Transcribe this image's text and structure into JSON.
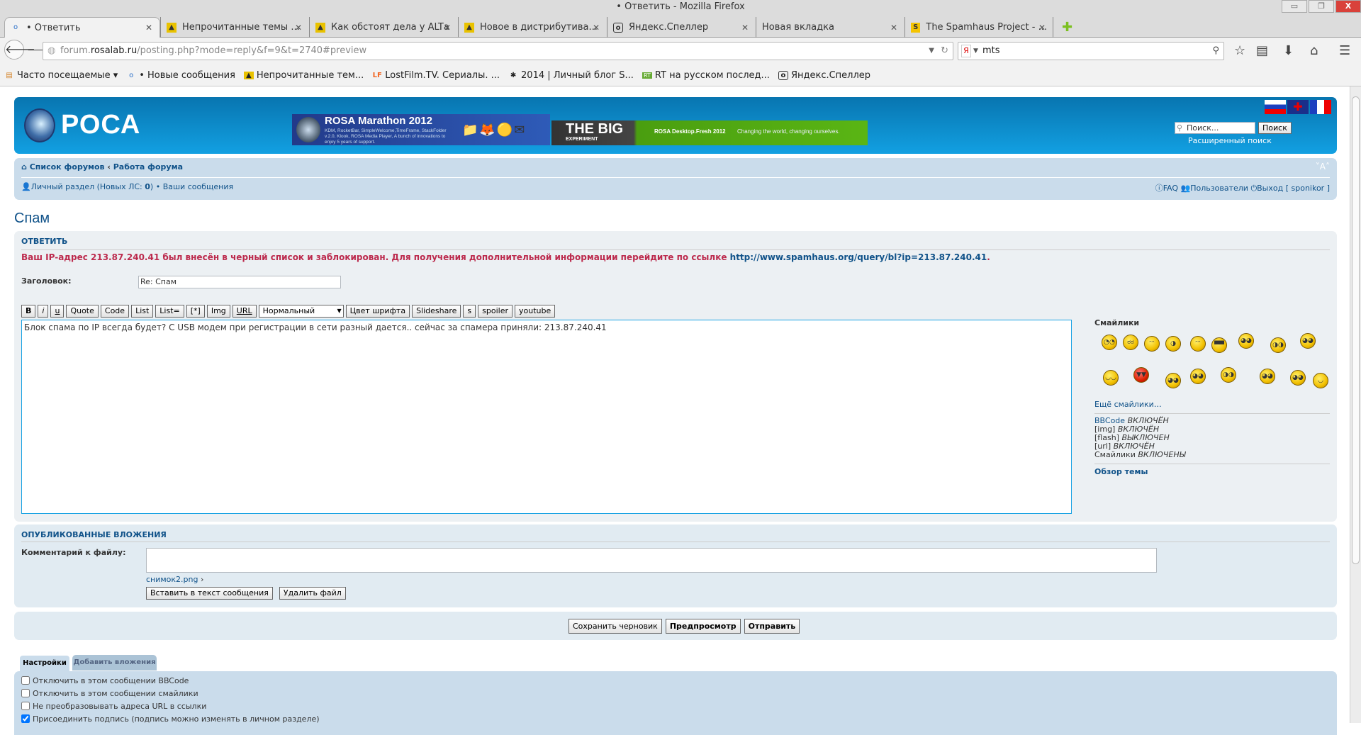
{
  "window": {
    "title": "• Ответить - Mozilla Firefox",
    "minimize": "▭",
    "restore": "❐",
    "close": "X"
  },
  "tabs": [
    {
      "label": "• Ответить",
      "icon": "o"
    },
    {
      "label": "Непрочитанные темы ...",
      "icon": "alt-linux-icon"
    },
    {
      "label": "Как обстоят дела у ALTа",
      "icon": "alt-linux-icon"
    },
    {
      "label": "Новое в дистрибутива...",
      "icon": "alt-linux-icon"
    },
    {
      "label": "Яндекс.Спеллер",
      "icon": "o"
    },
    {
      "label": "Новая вкладка",
      "icon": ""
    },
    {
      "label": "The Spamhaus Project - ...",
      "icon": "S"
    }
  ],
  "tab_close": "✕",
  "new_tab": "✚",
  "address": {
    "host_pre": "forum.",
    "host": "rosalab.ru",
    "path": "/posting.php?mode=reply&f=9&t=2740#preview"
  },
  "search": {
    "engine": "Я",
    "value": "mts"
  },
  "bookmarks": [
    {
      "label": "Часто посещаемые ▾",
      "icon": "▤"
    },
    {
      "label": "• Новые сообщения",
      "icon": "o"
    },
    {
      "label": "Непрочитанные тем...",
      "icon": "▲"
    },
    {
      "label": "LostFilm.TV. Сериалы. ...",
      "icon": "LF"
    },
    {
      "label": "2014 | Личный блог S...",
      "icon": "✱"
    },
    {
      "label": "RT на русском послед...",
      "icon": "RT"
    },
    {
      "label": "Яндекс.Спеллер",
      "icon": "o"
    }
  ],
  "site": {
    "logo": "РОСА",
    "banner1": {
      "title": "ROSA Marathon 2012",
      "text": "KDM, RocketBar, SimpleWelcome,TimeFrame, StackFolder v.2.0, Klook, ROSA Media Player, A bunch of innovations to enjoy 5 years of support."
    },
    "banner2": {
      "big": "THE BIG",
      "sub": "EXPERIMENT",
      "text": "ROSA Desktop.Fresh 2012",
      "tagline": "Changing the world, changing ourselves."
    },
    "search_placeholder": "Поиск...",
    "search_button": "Поиск",
    "advanced_search": "Расширенный поиск",
    "font_size": "˅A˄"
  },
  "nav": {
    "forums": "Список форумов",
    "sep": "‹",
    "section": "Работа форума",
    "personal": "Личный раздел (Новых ЛС: ",
    "pm_count": "0",
    "personal_end": ")",
    "bullet": "•",
    "your_posts": "Ваши сообщения",
    "faq": "FAQ",
    "users": "Пользователи",
    "logout": "Выход [ sponikor ]"
  },
  "page_title": "Спам",
  "post": {
    "heading": "ОТВЕТИТЬ",
    "notice": "Ваш IP-адрес 213.87.240.41 был внесён в черный список и заблокирован. Для получения дополнительной информации перейдите по ссылке ",
    "notice_link": "http://www.spamhaus.org/query/bl?ip=213.87.240.41",
    "notice_end": ".",
    "subject_label": "Заголовок:",
    "subject_value": "Re: Спам",
    "toolbar": [
      "B",
      "i",
      "u",
      "Quote",
      "Code",
      "List",
      "List=",
      "[*]",
      "Img",
      "URL"
    ],
    "font_size_select": "Нормальный",
    "toolbar2": [
      "Цвет шрифта",
      "Slideshare",
      "s",
      "spoiler",
      "youtube"
    ],
    "message": "Блок спама по IP всегда будет? С USB модем при регистрации в сети разный дается.. сейчас за спамера приняли: 213.87.240.41"
  },
  "smilies": {
    "title": "Смайлики",
    "more": "Ещё смайлики…",
    "items": [
      "◔◔",
      "ಠಠ",
      "ᵔᵔ",
      "◑",
      "ᵔᵔ",
      "▀▀",
      "◕◕",
      "◑◑",
      "◕◕",
      "◡◡",
      "▼▼",
      "◕◕",
      "◕◕",
      "◑◑",
      "◕◕",
      "◕◕",
      "◡"
    ],
    "status": [
      {
        "k": "BBCode",
        "v": "ВКЛЮЧЁН"
      },
      {
        "k": "[img]",
        "v": "ВКЛЮЧЁН"
      },
      {
        "k": "[flash]",
        "v": "ВЫКЛЮЧЕН"
      },
      {
        "k": "[url]",
        "v": "ВКЛЮЧЁН"
      },
      {
        "k": "Смайлики",
        "v": "ВКЛЮЧЕНЫ"
      }
    ],
    "topic_review": "Обзор темы"
  },
  "attachments": {
    "heading": "ОПУБЛИКОВАННЫЕ ВЛОЖЕНИЯ",
    "comment_label": "Комментарий к файлу:",
    "comment_value": "",
    "file": "снимок2.png",
    "file_arrow": "›",
    "insert": "Вставить в текст сообщения",
    "delete": "Удалить файл"
  },
  "submit": {
    "save": "Сохранить черновик",
    "preview": "Предпросмотр",
    "send": "Отправить"
  },
  "option_tabs": [
    "Настройки",
    "Добавить вложения"
  ],
  "options": [
    {
      "label": "Отключить в этом сообщении BBCode",
      "checked": false
    },
    {
      "label": "Отключить в этом сообщении смайлики",
      "checked": false
    },
    {
      "label": "Не преобразовывать адреса URL в ссылки",
      "checked": false
    },
    {
      "label": "Присоединить подпись (подпись можно изменять в личном разделе)",
      "checked": true
    }
  ]
}
